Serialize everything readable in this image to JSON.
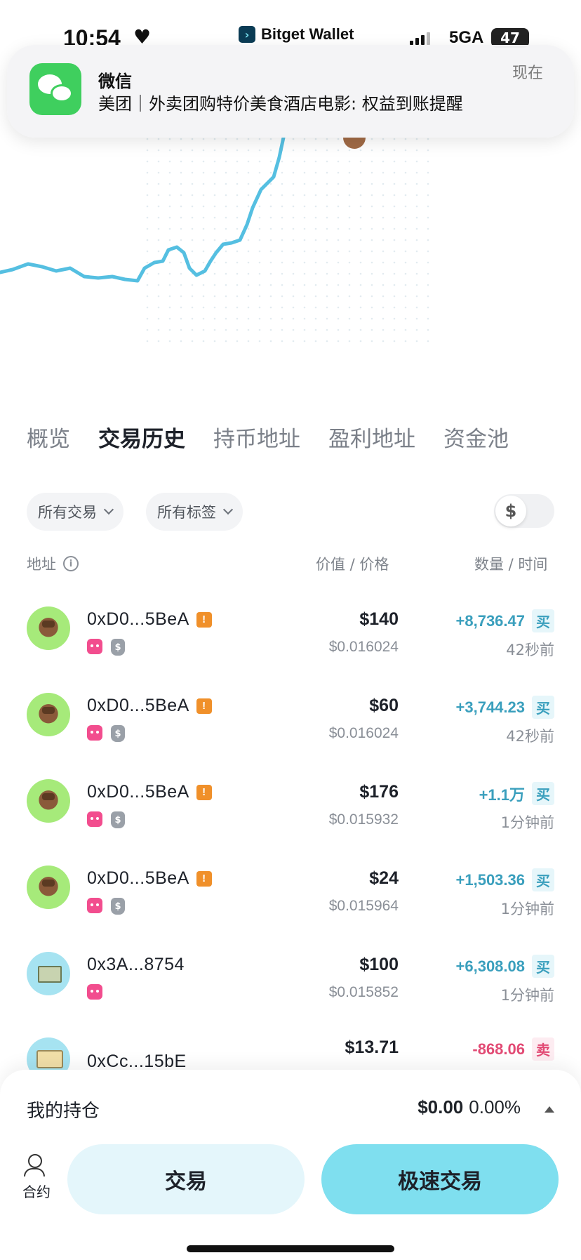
{
  "status_bar": {
    "time": "10:54",
    "app_name": "Bitget Wallet",
    "network": "5GA",
    "battery": "47"
  },
  "notification": {
    "app": "微信",
    "body": "美团｜外卖团购特价美食酒店电影: 权益到账提醒",
    "time": "现在"
  },
  "tabs": [
    {
      "label": "概览",
      "active": false
    },
    {
      "label": "交易历史",
      "active": true
    },
    {
      "label": "持币地址",
      "active": false
    },
    {
      "label": "盈利地址",
      "active": false
    },
    {
      "label": "资金池",
      "active": false
    }
  ],
  "filters": {
    "tx_type": "所有交易",
    "tags": "所有标签",
    "currency_toggle_icon": "$"
  },
  "table_header": {
    "address": "地址",
    "value_price": "价值 / 价格",
    "qty_time": "数量 / 时间"
  },
  "rows": [
    {
      "avatar": "cat",
      "address": "0xD0...5BeA",
      "warn": true,
      "tags": [
        "bot",
        "bag"
      ],
      "value": "$140",
      "price": "$0.016024",
      "qty": "+8,736.47",
      "side": "买",
      "side_type": "buy",
      "time": "42秒前"
    },
    {
      "avatar": "cat",
      "address": "0xD0...5BeA",
      "warn": true,
      "tags": [
        "bot",
        "bag"
      ],
      "value": "$60",
      "price": "$0.016024",
      "qty": "+3,744.23",
      "side": "买",
      "side_type": "buy",
      "time": "42秒前"
    },
    {
      "avatar": "cat",
      "address": "0xD0...5BeA",
      "warn": true,
      "tags": [
        "bot",
        "bag"
      ],
      "value": "$176",
      "price": "$0.015932",
      "qty": "+1.1万",
      "side": "买",
      "side_type": "buy",
      "time": "1分钟前"
    },
    {
      "avatar": "cat",
      "address": "0xD0...5BeA",
      "warn": true,
      "tags": [
        "bot",
        "bag"
      ],
      "value": "$24",
      "price": "$0.015964",
      "qty": "+1,503.36",
      "side": "买",
      "side_type": "buy",
      "time": "1分钟前"
    },
    {
      "avatar": "money",
      "address": "0x3A...8754",
      "warn": false,
      "tags": [
        "bot"
      ],
      "value": "$100",
      "price": "$0.015852",
      "qty": "+6,308.08",
      "side": "买",
      "side_type": "buy",
      "time": "1分钟前"
    },
    {
      "avatar": "card",
      "address": "0xCc...15bE",
      "warn": false,
      "tags": [],
      "value": "$13.71",
      "price": "",
      "qty": "-868.06",
      "side": "卖",
      "side_type": "sell",
      "time": ""
    }
  ],
  "holdings": {
    "label": "我的持仓",
    "value": "$0.00",
    "percent": "0.00%"
  },
  "bottom_nav": {
    "contract_label": "合约",
    "trade_label": "交易",
    "fast_trade_label": "极速交易"
  },
  "colors": {
    "accent": "#7fdfef",
    "buy": "#3a9fbd",
    "sell": "#e24a74",
    "chart_line": "#55bfe1"
  }
}
